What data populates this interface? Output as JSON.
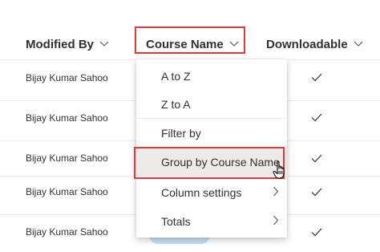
{
  "header": {
    "modified_by": "Modified By",
    "course_name": "Course Name",
    "downloadable": "Downloadable"
  },
  "rows": [
    {
      "modified_by": "Bijay Kumar Sahoo",
      "downloadable": true
    },
    {
      "modified_by": "Bijay Kumar Sahoo",
      "downloadable": true
    },
    {
      "modified_by": "Bijay Kumar Sahoo",
      "downloadable": true
    },
    {
      "modified_by": "Bijay Kumar Sahoo",
      "downloadable": true
    },
    {
      "modified_by": "Bijay Kumar Sahoo",
      "downloadable": true
    }
  ],
  "menu": {
    "items": [
      {
        "label": "A to Z"
      },
      {
        "label": "Z to A"
      },
      {
        "label": "Filter by"
      },
      {
        "label": "Group by Course Name"
      },
      {
        "label": "Column settings",
        "submenu": true
      },
      {
        "label": "Totals",
        "submenu": true
      }
    ]
  },
  "colors": {
    "highlight": "#e0393e",
    "pill": "#c7e0f4",
    "text": "#323130"
  },
  "icons": {
    "sort_chevron": "chevron-down-icon",
    "check": "check-icon",
    "submenu": "chevron-right-icon",
    "cursor": "hand-pointer-icon"
  }
}
